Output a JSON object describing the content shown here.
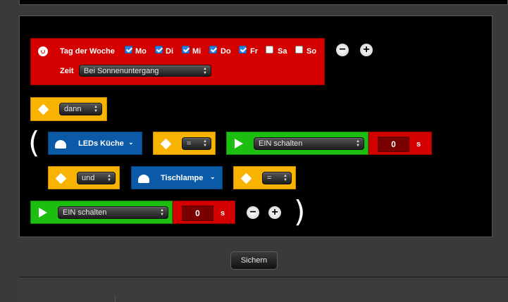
{
  "trigger": {
    "weekday_label": "Tag der Woche",
    "days": [
      {
        "label": "Mo",
        "checked": true
      },
      {
        "label": "Di",
        "checked": true
      },
      {
        "label": "Mi",
        "checked": true
      },
      {
        "label": "Do",
        "checked": true
      },
      {
        "label": "Fr",
        "checked": true
      },
      {
        "label": "Sa",
        "checked": false
      },
      {
        "label": "So",
        "checked": false
      }
    ],
    "time_label": "Zeit",
    "time_value": "Bei Sonnenuntergang"
  },
  "then_select": "dann",
  "cond1": {
    "device": "LEDs Küche",
    "operator": "=",
    "action": "EIN schalten",
    "delay": "0",
    "unit": "s"
  },
  "cond2": {
    "conjunction": "und",
    "device": "Tischlampe",
    "operator": "="
  },
  "action_final": {
    "action": "EIN schalten",
    "delay": "0",
    "unit": "s"
  },
  "buttons": {
    "minus": "−",
    "plus": "+",
    "save": "Sichern"
  },
  "parens": {
    "open": "(",
    "close": ")"
  },
  "colors": {
    "red": "#d40000",
    "yellow": "#f8b200",
    "blue": "#0a5aa8",
    "green": "#1cbf10"
  }
}
